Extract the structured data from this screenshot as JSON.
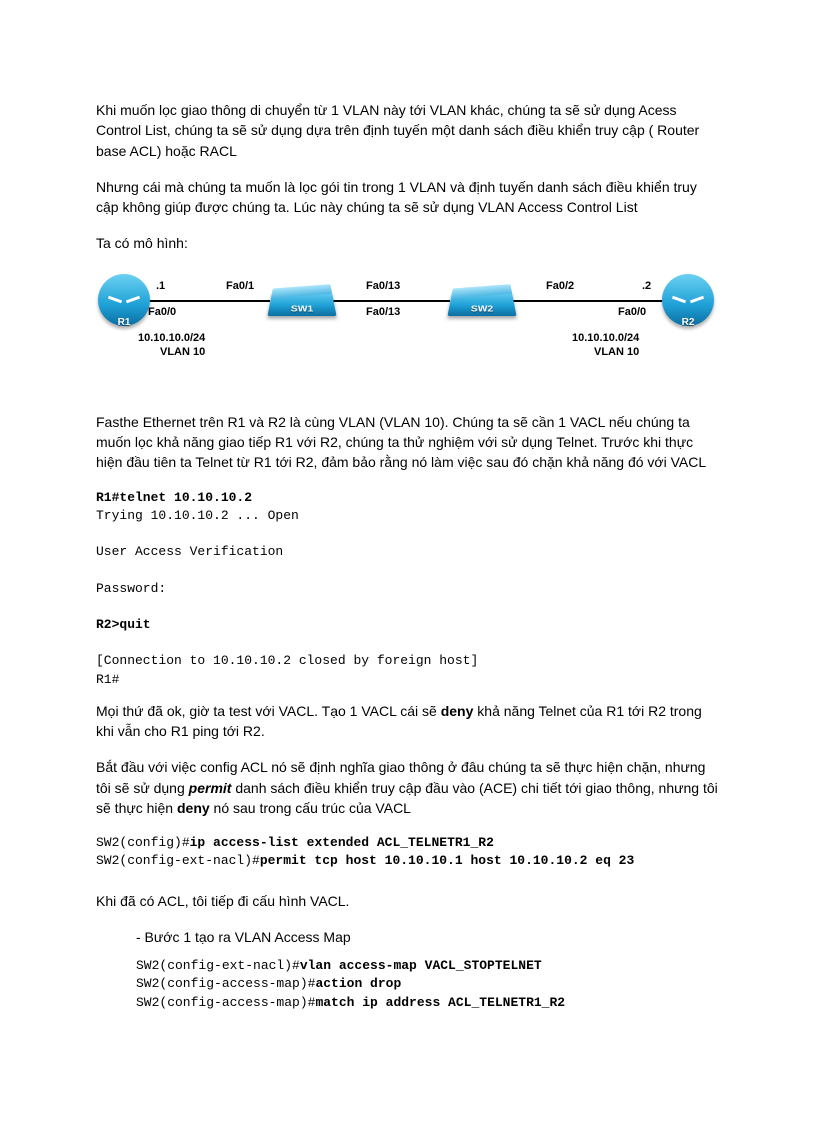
{
  "para1": "Khi muốn lọc giao thông di chuyển từ 1 VLAN này tới VLAN khác, chúng ta sẽ sử dụng Acess Control List, chúng ta sẽ sử dụng dựa trên định tuyến một danh sách điều khiển truy cập ( Router base ACL) hoặc RACL",
  "para2": "Nhưng cái mà chúng ta muốn là lọc gói tin trong 1 VLAN và định tuyến danh sách điều khiển truy cập không giúp được chúng ta. Lúc này chúng ta sẽ sử dụng VLAN Access Control List",
  "para3": "Ta có mô hình:",
  "diagram": {
    "r1": "R1",
    "r2": "R2",
    "sw1": "SW1",
    "sw2": "SW2",
    "ip1": ".1",
    "ip2": ".2",
    "fa00_l": "Fa0/0",
    "fa01": "Fa0/1",
    "fa013_top": "Fa0/13",
    "fa013_bot": "Fa0/13",
    "fa02": "Fa0/2",
    "fa00_r": "Fa0/0",
    "net_l": "10.10.10.0/24",
    "vlan_l": "VLAN 10",
    "net_r": "10.10.10.0/24",
    "vlan_r": "VLAN 10"
  },
  "para4": "Fasthe Ethernet trên R1 và R2 là cùng VLAN (VLAN 10). Chúng ta sẽ cần 1 VACL nếu chúng ta muốn lọc khả năng giao tiếp R1 với R2, chúng ta thử nghiệm với sử dụng Telnet. Trước khi thực hiện đầu tiên ta Telnet từ R1 tới R2, đảm bảo rằng nó làm việc sau đó chặn khả năng đó với VACL",
  "term1": {
    "l1a": "R1#",
    "l1b": "telnet 10.10.10.2",
    "l2": "Trying 10.10.10.2 ... Open",
    "l3": "User Access Verification",
    "l4": "Password:",
    "l5a": "R2>",
    "l5b": "quit",
    "l6": "[Connection to 10.10.10.2 closed by foreign host]",
    "l7": "R1#"
  },
  "para5a": "Mọi thứ đã ok, giờ ta test với VACL. Tạo 1 VACL cái sẽ ",
  "para5b": "deny",
  "para5c": " khả năng Telnet của R1 tới R2 trong khi vẫn cho R1 ping tới R2.",
  "para6a": "Bắt đầu với việc config ACL nó sẽ định nghĩa giao thông ở đâu chúng ta sẽ thực hiện chặn, nhưng tôi sẽ sử dụng ",
  "para6b": "permit",
  "para6c": " danh sách điều khiển truy cập đầu vào (ACE)  chi tiết tới giao thông, nhưng tôi sẽ thực hiện ",
  "para6d": "deny",
  "para6e": " nó sau trong cấu trúc của VACL",
  "term2": {
    "l1a": "SW2(config)#",
    "l1b": "ip access-list extended ACL_TELNETR1_R2",
    "l2a": "SW2(config-ext-nacl)#",
    "l2b": "permit tcp host 10.10.10.1 host 10.10.10.2 eq 23"
  },
  "para7": "Khi đã có ACL, tôi tiếp đi cấu hình VACL.",
  "bullet1": "-   Bước 1 tạo ra VLAN Access Map",
  "term3": {
    "l1a": "SW2(config-ext-nacl)#",
    "l1b": "vlan access-map VACL_STOPTELNET",
    "l2a": "SW2(config-access-map)#",
    "l2b": "action drop",
    "l3a": "SW2(config-access-map)#",
    "l3b": "match ip address ACL_TELNETR1_R2"
  }
}
